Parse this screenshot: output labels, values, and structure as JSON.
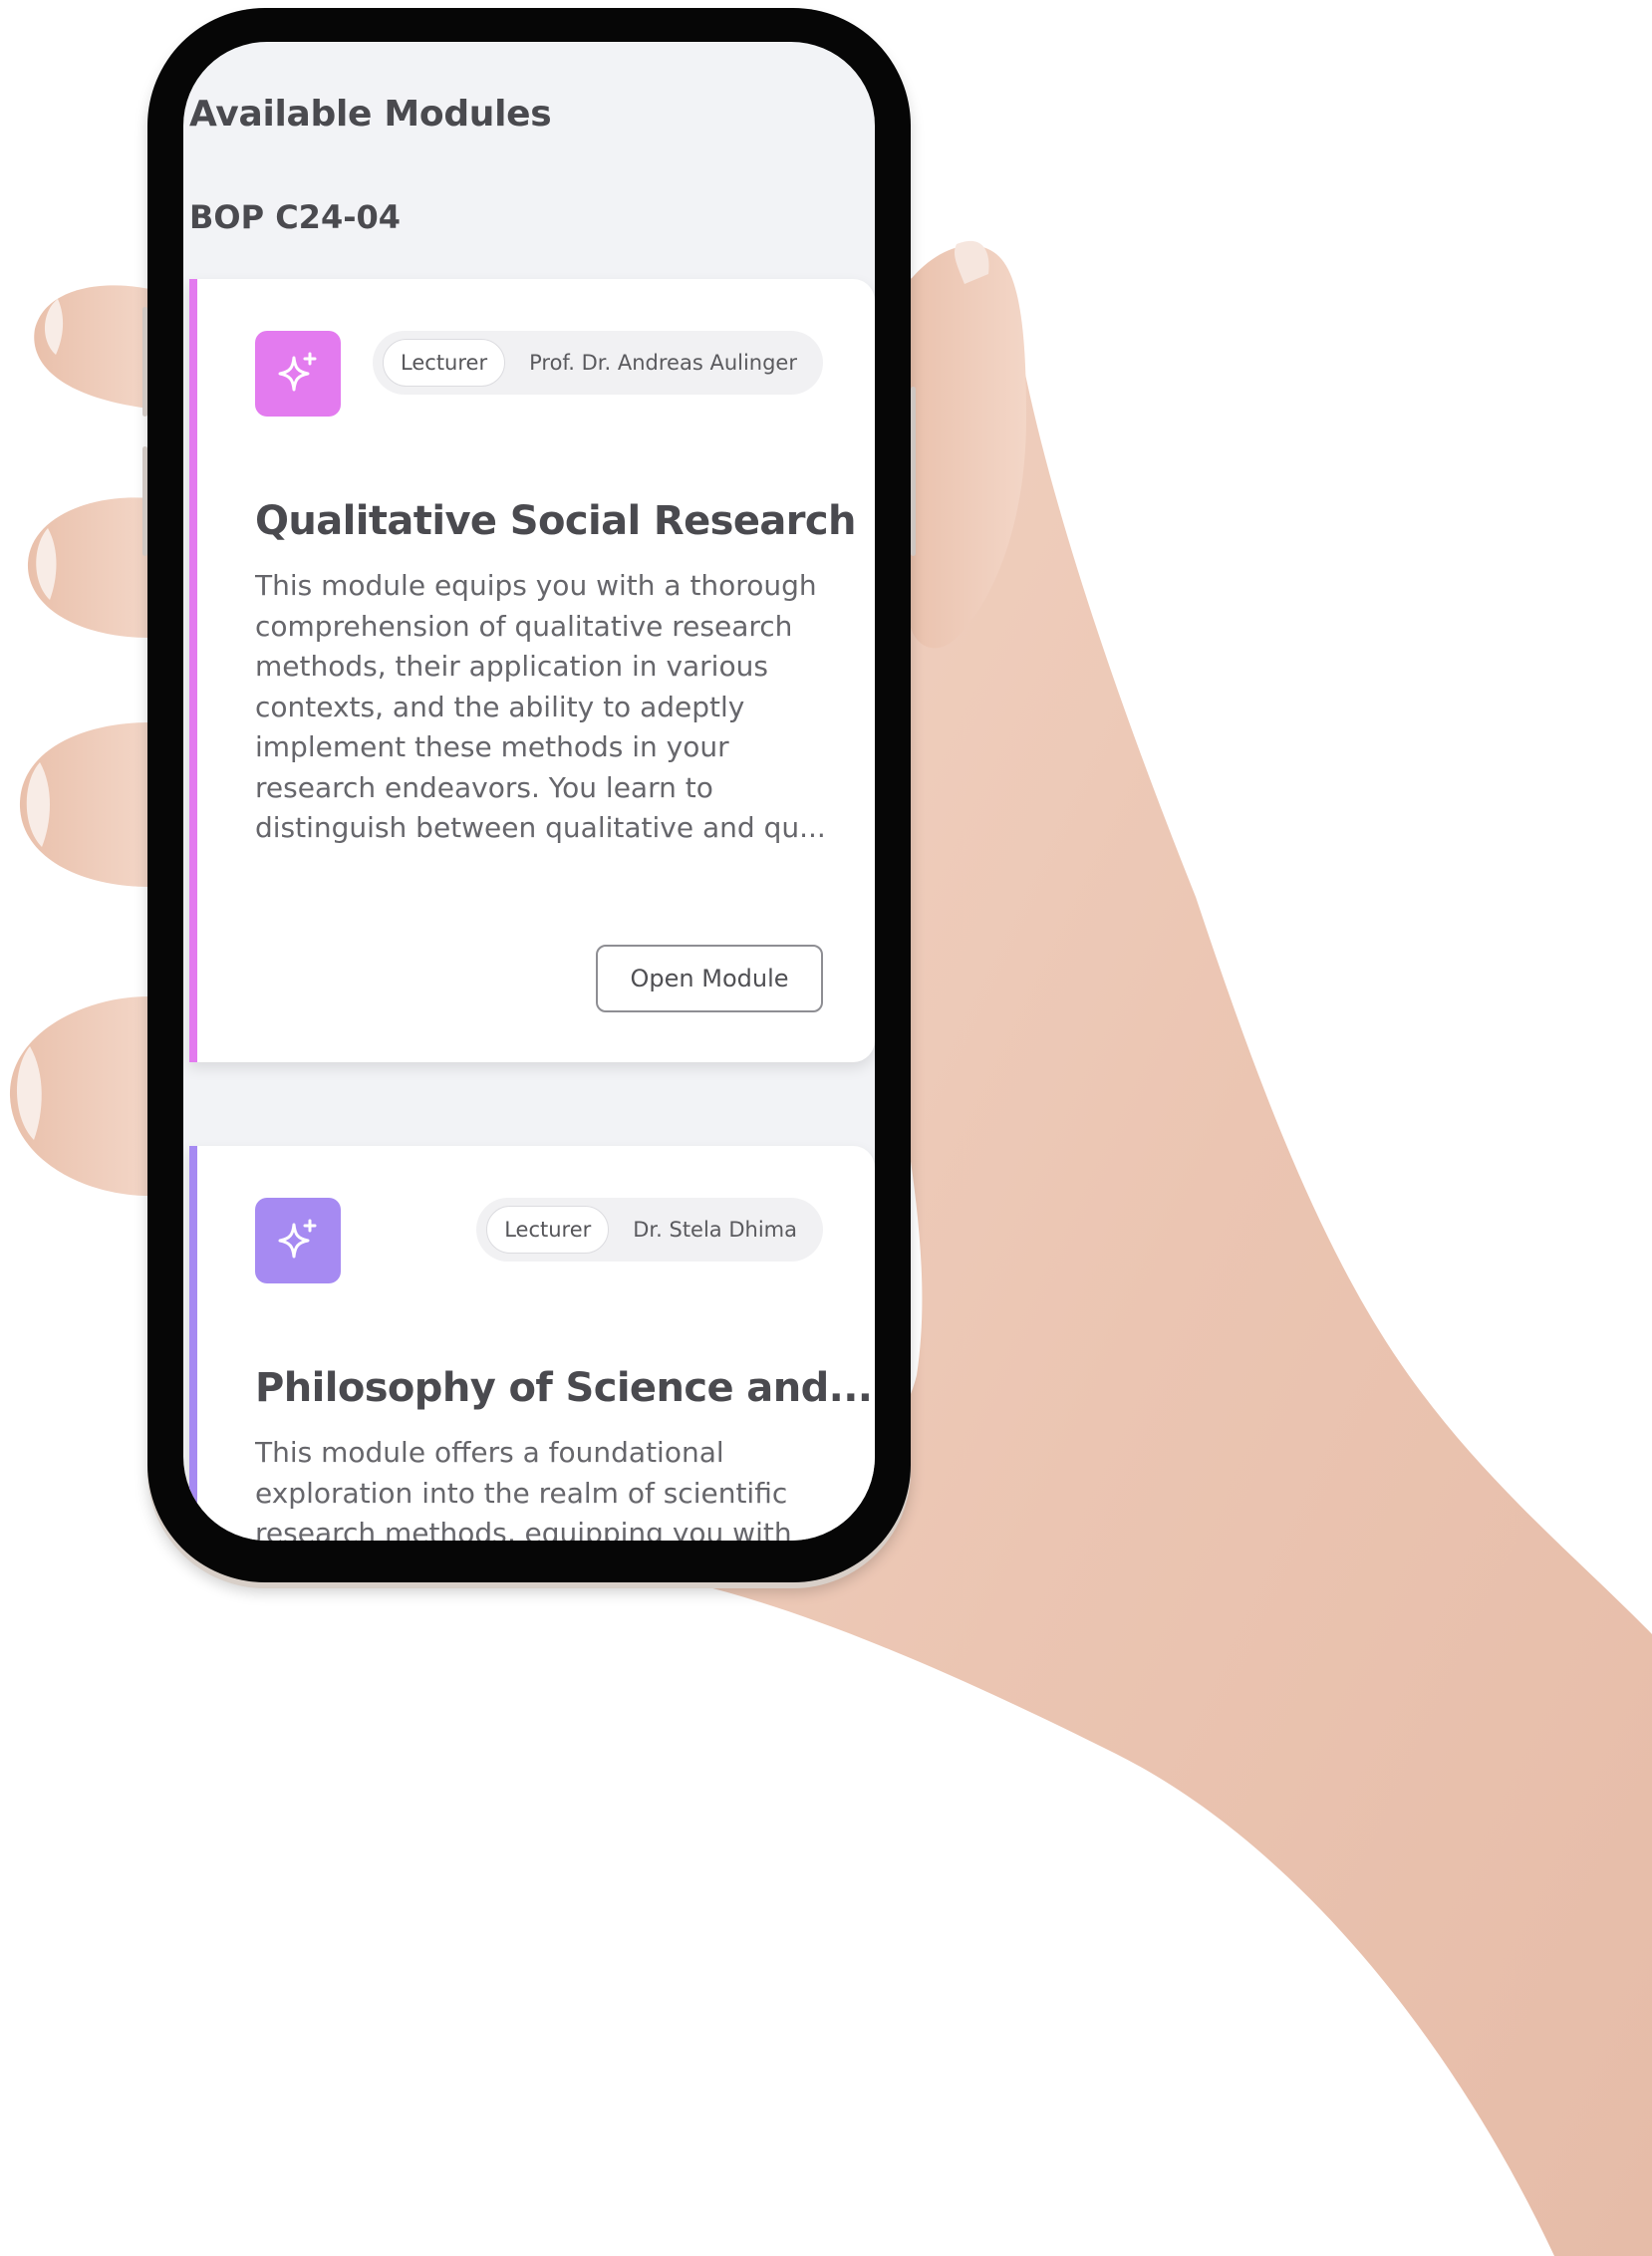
{
  "page": {
    "title": "Available Modules",
    "cohort": "BOP C24-04"
  },
  "modules": [
    {
      "accent_color": "#e37bef",
      "icon": "sparkle-icon",
      "lecturer_tag": "Lecturer",
      "lecturer_name": "Prof. Dr. Andreas Aulinger",
      "title": "Qualitative Social Research",
      "description_lines": [
        "This module equips you with a thorough",
        "comprehension of qualitative research",
        "methods, their application in various",
        "contexts, and the ability to adeptly",
        "implement these methods in your",
        "research endeavors. You learn to",
        "distinguish between qualitative and qu..."
      ],
      "button_label": "Open Module"
    },
    {
      "accent_color": "#a68af2",
      "icon": "sparkle-icon",
      "lecturer_tag": "Lecturer",
      "lecturer_name": "Dr. Stela Dhima",
      "title": "Philosophy of Science and...",
      "description_lines": [
        "This module offers a foundational",
        "exploration into the realm of scientific",
        "research methods, equipping you with"
      ]
    }
  ]
}
